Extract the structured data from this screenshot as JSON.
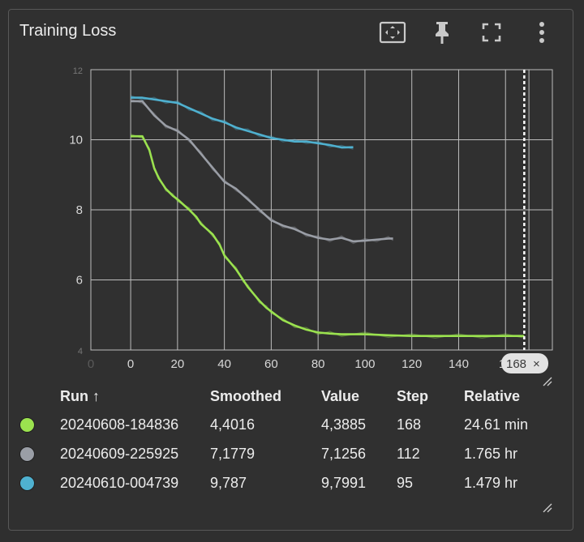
{
  "card": {
    "title": "Training Loss"
  },
  "toolbar": {
    "icons": [
      "fit-domain-icon",
      "pin-icon",
      "fullscreen-icon",
      "more-vert-icon"
    ]
  },
  "cursor": {
    "step_label": "168",
    "close_glyph": "×"
  },
  "legend": {
    "headers": {
      "run": "Run ↑",
      "smoothed": "Smoothed",
      "value": "Value",
      "step": "Step",
      "relative": "Relative"
    },
    "rows": [
      {
        "color": "#9be24f",
        "run": "20240608-184836",
        "smoothed": "4,4016",
        "value": "4,3885",
        "step": "168",
        "relative": "24.61 min"
      },
      {
        "color": "#9a9ea6",
        "run": "20240609-225925",
        "smoothed": "7,1779",
        "value": "7,1256",
        "step": "112",
        "relative": "1.765 hr"
      },
      {
        "color": "#4fb1d0",
        "run": "20240610-004739",
        "smoothed": "9,787",
        "value": "9,7991",
        "step": "95",
        "relative": "1.479 hr"
      }
    ]
  },
  "chart_data": {
    "type": "line",
    "title": "Training Loss",
    "xlabel": "",
    "ylabel": "",
    "xlim": [
      -17,
      180
    ],
    "ylim": [
      4,
      12
    ],
    "x_ticks": [
      "0",
      "0",
      "20",
      "40",
      "60",
      "80",
      "100",
      "120",
      "140",
      "16"
    ],
    "x_tick_values": [
      -17,
      0,
      20,
      40,
      60,
      80,
      100,
      120,
      140,
      160
    ],
    "y_ticks": [
      "4",
      "6",
      "8",
      "10",
      "12"
    ],
    "y_tick_values": [
      4,
      6,
      8,
      10,
      12
    ],
    "grid": true,
    "cursor_step": 168,
    "series": [
      {
        "name": "20240608-184836",
        "color": "#9be24f",
        "x": [
          0,
          5,
          8,
          10,
          12,
          15,
          18,
          20,
          25,
          28,
          30,
          35,
          38,
          40,
          45,
          48,
          50,
          55,
          58,
          60,
          65,
          70,
          75,
          80,
          85,
          90,
          100,
          110,
          120,
          130,
          140,
          150,
          160,
          168
        ],
        "y": [
          10.1,
          10.1,
          9.7,
          9.2,
          8.9,
          8.6,
          8.4,
          8.3,
          8.0,
          7.8,
          7.6,
          7.3,
          7.0,
          6.7,
          6.3,
          6.0,
          5.8,
          5.4,
          5.2,
          5.1,
          4.85,
          4.7,
          4.58,
          4.5,
          4.47,
          4.45,
          4.45,
          4.42,
          4.4,
          4.4,
          4.4,
          4.4,
          4.4,
          4.4
        ]
      },
      {
        "name": "20240609-225925",
        "color": "#9a9ea6",
        "x": [
          0,
          5,
          10,
          15,
          20,
          25,
          30,
          35,
          40,
          45,
          50,
          55,
          60,
          65,
          70,
          75,
          80,
          85,
          90,
          95,
          100,
          105,
          110,
          112
        ],
        "y": [
          11.1,
          11.1,
          10.7,
          10.4,
          10.25,
          10.0,
          9.6,
          9.2,
          8.8,
          8.6,
          8.3,
          8.0,
          7.7,
          7.55,
          7.45,
          7.3,
          7.2,
          7.15,
          7.2,
          7.1,
          7.12,
          7.15,
          7.18,
          7.18
        ]
      },
      {
        "name": "20240610-004739",
        "color": "#4fb1d0",
        "x": [
          0,
          5,
          10,
          15,
          20,
          25,
          30,
          35,
          40,
          45,
          50,
          55,
          60,
          65,
          70,
          75,
          80,
          85,
          90,
          95
        ],
        "y": [
          11.2,
          11.2,
          11.15,
          11.1,
          11.05,
          10.9,
          10.75,
          10.6,
          10.5,
          10.35,
          10.25,
          10.15,
          10.05,
          10.0,
          9.95,
          9.95,
          9.9,
          9.85,
          9.78,
          9.787
        ]
      }
    ]
  }
}
